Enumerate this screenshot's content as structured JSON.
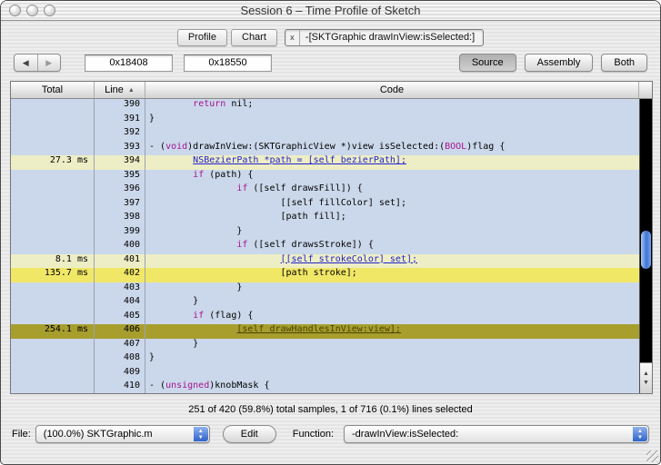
{
  "window": {
    "title": "Session 6 – Time Profile of Sketch"
  },
  "icons": {
    "back": "◀",
    "forward": "▶",
    "sort_asc": "▲",
    "up": "▲",
    "down": "▼"
  },
  "tabs": {
    "profile": "Profile",
    "chart": "Chart",
    "active_close": "x",
    "active_label": "-[SKTGraphic drawInView:isSelected:]"
  },
  "toolbar": {
    "start_address": "0x18408",
    "end_address": "0x18550",
    "source_label": "Source",
    "assembly_label": "Assembly",
    "both_label": "Both"
  },
  "table": {
    "columns": [
      "Total",
      "Line",
      "Code"
    ],
    "rows": [
      {
        "line": "390",
        "total": "",
        "style": "",
        "code": [
          {
            "t": "        ",
            "c": "p"
          },
          {
            "t": "return",
            "c": "k"
          },
          {
            "t": " nil;",
            "c": "p"
          }
        ]
      },
      {
        "line": "391",
        "total": "",
        "style": "",
        "code": [
          {
            "t": "}",
            "c": "p"
          }
        ]
      },
      {
        "line": "392",
        "total": "",
        "style": "",
        "code": []
      },
      {
        "line": "393",
        "total": "",
        "style": "",
        "code": [
          {
            "t": "- (",
            "c": "p"
          },
          {
            "t": "void",
            "c": "k"
          },
          {
            "t": ")drawInView:(SKTGraphicView *)view isSelected:(",
            "c": "p"
          },
          {
            "t": "BOOL",
            "c": "k"
          },
          {
            "t": ")flag {",
            "c": "p"
          }
        ]
      },
      {
        "line": "394",
        "total": "27.3 ms",
        "style": "hot1",
        "code": [
          {
            "t": "        ",
            "c": "p"
          },
          {
            "t": "NSBezierPath *path = [self bezierPath];",
            "c": "u"
          }
        ]
      },
      {
        "line": "395",
        "total": "",
        "style": "",
        "code": [
          {
            "t": "        ",
            "c": "p"
          },
          {
            "t": "if",
            "c": "k"
          },
          {
            "t": " (path) {",
            "c": "p"
          }
        ]
      },
      {
        "line": "396",
        "total": "",
        "style": "",
        "code": [
          {
            "t": "                ",
            "c": "p"
          },
          {
            "t": "if",
            "c": "k"
          },
          {
            "t": " ([self drawsFill]) {",
            "c": "p"
          }
        ]
      },
      {
        "line": "397",
        "total": "",
        "style": "",
        "code": [
          {
            "t": "                        [[self fillColor] set];",
            "c": "p"
          }
        ]
      },
      {
        "line": "398",
        "total": "",
        "style": "",
        "code": [
          {
            "t": "                        [path fill];",
            "c": "p"
          }
        ]
      },
      {
        "line": "399",
        "total": "",
        "style": "",
        "code": [
          {
            "t": "                }",
            "c": "p"
          }
        ]
      },
      {
        "line": "400",
        "total": "",
        "style": "",
        "code": [
          {
            "t": "                ",
            "c": "p"
          },
          {
            "t": "if",
            "c": "k"
          },
          {
            "t": " ([self drawsStroke]) {",
            "c": "p"
          }
        ]
      },
      {
        "line": "401",
        "total": "8.1 ms",
        "style": "hot1",
        "code": [
          {
            "t": "                        ",
            "c": "p"
          },
          {
            "t": "[[self strokeColor] set];",
            "c": "u"
          }
        ]
      },
      {
        "line": "402",
        "total": "135.7 ms",
        "style": "hot2",
        "code": [
          {
            "t": "                        [path stroke];",
            "c": "p"
          }
        ]
      },
      {
        "line": "403",
        "total": "",
        "style": "",
        "code": [
          {
            "t": "                }",
            "c": "p"
          }
        ]
      },
      {
        "line": "404",
        "total": "",
        "style": "",
        "code": [
          {
            "t": "        }",
            "c": "p"
          }
        ]
      },
      {
        "line": "405",
        "total": "",
        "style": "",
        "code": [
          {
            "t": "        ",
            "c": "p"
          },
          {
            "t": "if",
            "c": "k"
          },
          {
            "t": " (flag) {",
            "c": "p"
          }
        ]
      },
      {
        "line": "406",
        "total": "254.1 ms",
        "style": "sel",
        "code": [
          {
            "t": "                ",
            "c": "p"
          },
          {
            "t": "[self drawHandlesInView:view];",
            "c": "u"
          }
        ]
      },
      {
        "line": "407",
        "total": "",
        "style": "",
        "code": [
          {
            "t": "        }",
            "c": "p"
          }
        ]
      },
      {
        "line": "408",
        "total": "",
        "style": "",
        "code": [
          {
            "t": "}",
            "c": "p"
          }
        ]
      },
      {
        "line": "409",
        "total": "",
        "style": "",
        "code": []
      },
      {
        "line": "410",
        "total": "",
        "style": "",
        "code": [
          {
            "t": "- (",
            "c": "p"
          },
          {
            "t": "unsigned",
            "c": "k"
          },
          {
            "t": ")knobMask {",
            "c": "p"
          }
        ]
      }
    ]
  },
  "status": {
    "text": "251 of 420 (59.8%) total samples, 1 of 716 (0.1%) lines selected"
  },
  "footer": {
    "file_label": "File:",
    "file_value": "(100.0%) SKTGraphic.m",
    "edit_label": "Edit",
    "function_label": "Function:",
    "function_value": "-drawInView:isSelected:"
  },
  "colors": {
    "row_blue": "#CBD8EB",
    "hot_pale_yellow": "#EDEEC5",
    "hot_yellow": "#F1E767",
    "selected_olive": "#A89E2E",
    "keyword": "#A5138F",
    "hot_link": "#2222CC",
    "scroll_knob_blue": "#3E74D6"
  }
}
